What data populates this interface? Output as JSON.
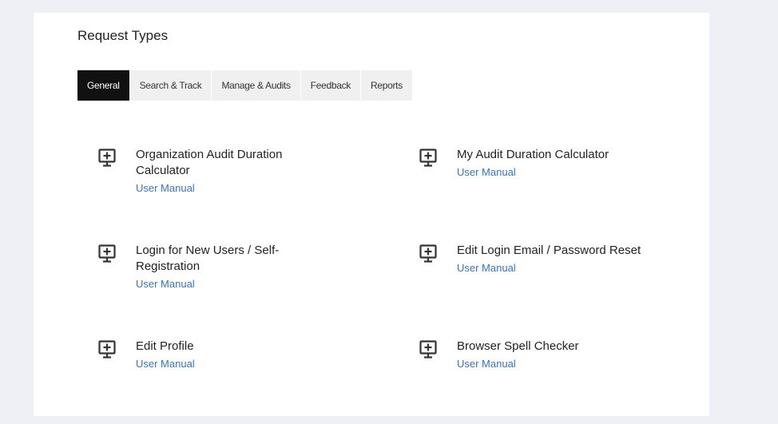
{
  "page": {
    "title": "Request Types"
  },
  "tabs": [
    {
      "label": "General",
      "active": true
    },
    {
      "label": "Search & Track",
      "active": false
    },
    {
      "label": "Manage & Audits",
      "active": false
    },
    {
      "label": "Feedback",
      "active": false
    },
    {
      "label": "Reports",
      "active": false
    }
  ],
  "items": [
    {
      "name": "Organization Audit Duration Calculator",
      "link": "User Manual",
      "icon": "monitor-plus-icon"
    },
    {
      "name": "My Audit Duration Calculator",
      "link": "User Manual",
      "icon": "monitor-plus-icon"
    },
    {
      "name": "Login for New Users / Self-Registration",
      "link": "User Manual",
      "icon": "monitor-plus-icon"
    },
    {
      "name": "Edit Login Email / Password Reset",
      "link": "User Manual",
      "icon": "monitor-plus-icon"
    },
    {
      "name": "Edit Profile",
      "link": "User Manual",
      "icon": "monitor-plus-icon"
    },
    {
      "name": "Browser Spell Checker",
      "link": "User Manual",
      "icon": "monitor-plus-icon"
    }
  ],
  "colors": {
    "active_tab_bg": "#111111",
    "tab_bg": "#f0f0f0",
    "link": "#3a73b7",
    "page_bg": "#eef0f6"
  }
}
